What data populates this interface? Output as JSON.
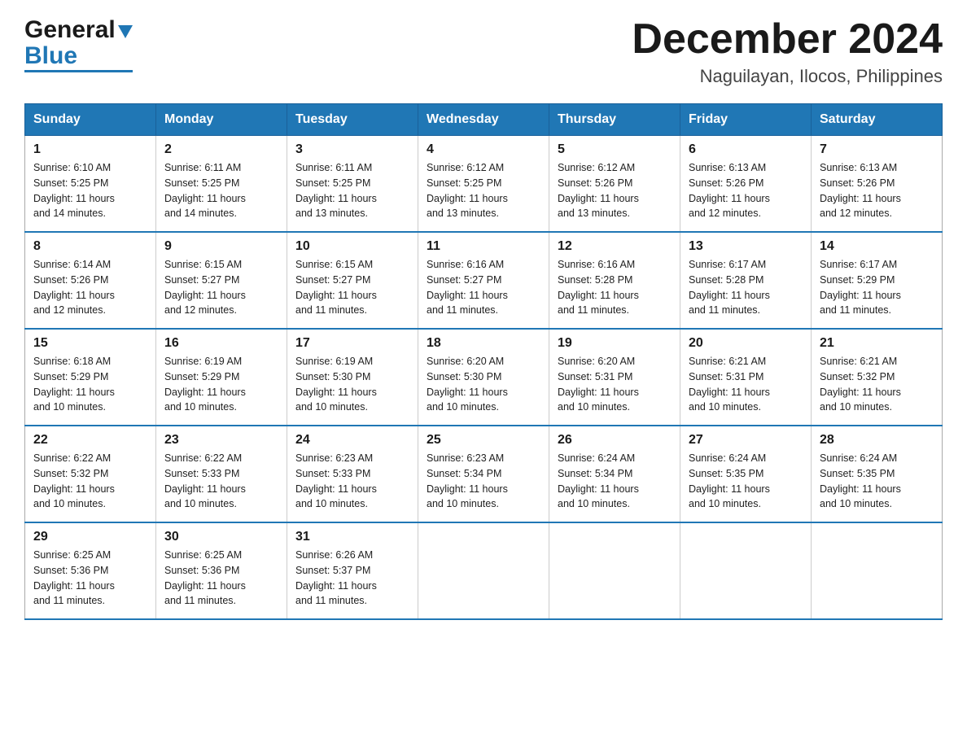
{
  "header": {
    "logo_general": "General",
    "logo_blue": "Blue",
    "month_title": "December 2024",
    "location": "Naguilayan, Ilocos, Philippines"
  },
  "calendar": {
    "days_of_week": [
      "Sunday",
      "Monday",
      "Tuesday",
      "Wednesday",
      "Thursday",
      "Friday",
      "Saturday"
    ],
    "weeks": [
      [
        {
          "day": "1",
          "sunrise": "6:10 AM",
          "sunset": "5:25 PM",
          "daylight": "11 hours and 14 minutes."
        },
        {
          "day": "2",
          "sunrise": "6:11 AM",
          "sunset": "5:25 PM",
          "daylight": "11 hours and 14 minutes."
        },
        {
          "day": "3",
          "sunrise": "6:11 AM",
          "sunset": "5:25 PM",
          "daylight": "11 hours and 13 minutes."
        },
        {
          "day": "4",
          "sunrise": "6:12 AM",
          "sunset": "5:25 PM",
          "daylight": "11 hours and 13 minutes."
        },
        {
          "day": "5",
          "sunrise": "6:12 AM",
          "sunset": "5:26 PM",
          "daylight": "11 hours and 13 minutes."
        },
        {
          "day": "6",
          "sunrise": "6:13 AM",
          "sunset": "5:26 PM",
          "daylight": "11 hours and 12 minutes."
        },
        {
          "day": "7",
          "sunrise": "6:13 AM",
          "sunset": "5:26 PM",
          "daylight": "11 hours and 12 minutes."
        }
      ],
      [
        {
          "day": "8",
          "sunrise": "6:14 AM",
          "sunset": "5:26 PM",
          "daylight": "11 hours and 12 minutes."
        },
        {
          "day": "9",
          "sunrise": "6:15 AM",
          "sunset": "5:27 PM",
          "daylight": "11 hours and 12 minutes."
        },
        {
          "day": "10",
          "sunrise": "6:15 AM",
          "sunset": "5:27 PM",
          "daylight": "11 hours and 11 minutes."
        },
        {
          "day": "11",
          "sunrise": "6:16 AM",
          "sunset": "5:27 PM",
          "daylight": "11 hours and 11 minutes."
        },
        {
          "day": "12",
          "sunrise": "6:16 AM",
          "sunset": "5:28 PM",
          "daylight": "11 hours and 11 minutes."
        },
        {
          "day": "13",
          "sunrise": "6:17 AM",
          "sunset": "5:28 PM",
          "daylight": "11 hours and 11 minutes."
        },
        {
          "day": "14",
          "sunrise": "6:17 AM",
          "sunset": "5:29 PM",
          "daylight": "11 hours and 11 minutes."
        }
      ],
      [
        {
          "day": "15",
          "sunrise": "6:18 AM",
          "sunset": "5:29 PM",
          "daylight": "11 hours and 10 minutes."
        },
        {
          "day": "16",
          "sunrise": "6:19 AM",
          "sunset": "5:29 PM",
          "daylight": "11 hours and 10 minutes."
        },
        {
          "day": "17",
          "sunrise": "6:19 AM",
          "sunset": "5:30 PM",
          "daylight": "11 hours and 10 minutes."
        },
        {
          "day": "18",
          "sunrise": "6:20 AM",
          "sunset": "5:30 PM",
          "daylight": "11 hours and 10 minutes."
        },
        {
          "day": "19",
          "sunrise": "6:20 AM",
          "sunset": "5:31 PM",
          "daylight": "11 hours and 10 minutes."
        },
        {
          "day": "20",
          "sunrise": "6:21 AM",
          "sunset": "5:31 PM",
          "daylight": "11 hours and 10 minutes."
        },
        {
          "day": "21",
          "sunrise": "6:21 AM",
          "sunset": "5:32 PM",
          "daylight": "11 hours and 10 minutes."
        }
      ],
      [
        {
          "day": "22",
          "sunrise": "6:22 AM",
          "sunset": "5:32 PM",
          "daylight": "11 hours and 10 minutes."
        },
        {
          "day": "23",
          "sunrise": "6:22 AM",
          "sunset": "5:33 PM",
          "daylight": "11 hours and 10 minutes."
        },
        {
          "day": "24",
          "sunrise": "6:23 AM",
          "sunset": "5:33 PM",
          "daylight": "11 hours and 10 minutes."
        },
        {
          "day": "25",
          "sunrise": "6:23 AM",
          "sunset": "5:34 PM",
          "daylight": "11 hours and 10 minutes."
        },
        {
          "day": "26",
          "sunrise": "6:24 AM",
          "sunset": "5:34 PM",
          "daylight": "11 hours and 10 minutes."
        },
        {
          "day": "27",
          "sunrise": "6:24 AM",
          "sunset": "5:35 PM",
          "daylight": "11 hours and 10 minutes."
        },
        {
          "day": "28",
          "sunrise": "6:24 AM",
          "sunset": "5:35 PM",
          "daylight": "11 hours and 10 minutes."
        }
      ],
      [
        {
          "day": "29",
          "sunrise": "6:25 AM",
          "sunset": "5:36 PM",
          "daylight": "11 hours and 11 minutes."
        },
        {
          "day": "30",
          "sunrise": "6:25 AM",
          "sunset": "5:36 PM",
          "daylight": "11 hours and 11 minutes."
        },
        {
          "day": "31",
          "sunrise": "6:26 AM",
          "sunset": "5:37 PM",
          "daylight": "11 hours and 11 minutes."
        },
        null,
        null,
        null,
        null
      ]
    ],
    "labels": {
      "sunrise": "Sunrise:",
      "sunset": "Sunset:",
      "daylight": "Daylight:"
    }
  }
}
